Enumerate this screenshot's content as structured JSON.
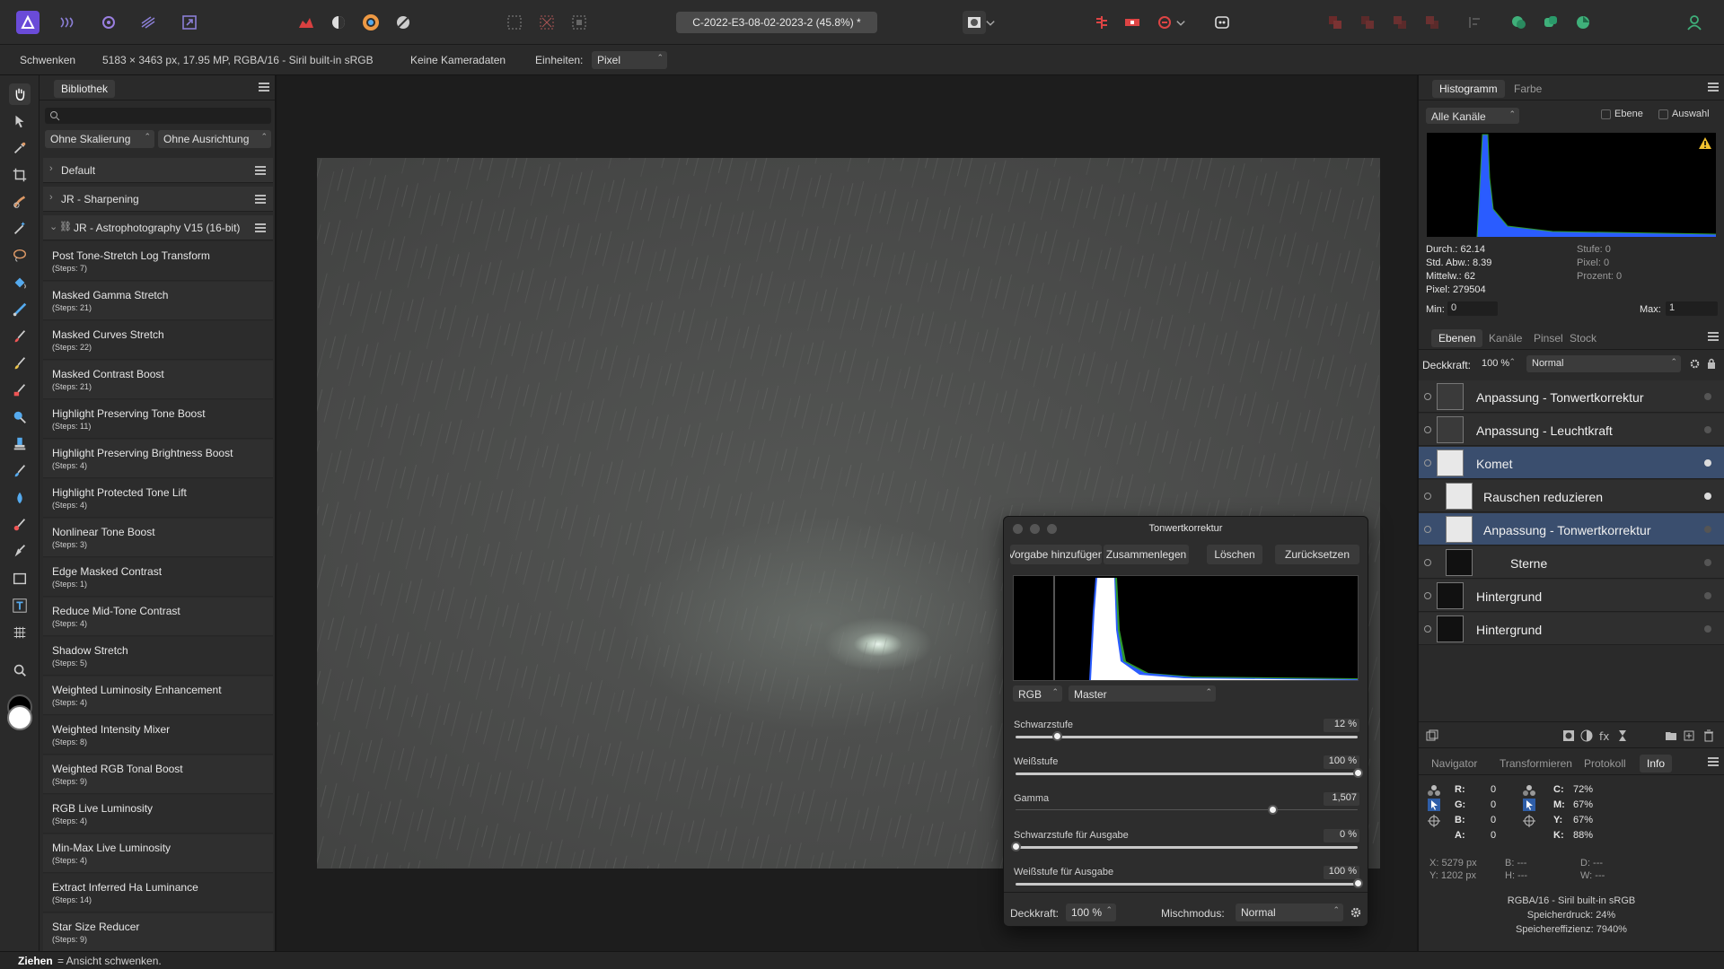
{
  "toolbar": {
    "document_title": "C-2022-E3-08-02-2023-2 (45.8%)",
    "document_modified": "*"
  },
  "context": {
    "tool": "Schwenken",
    "image_info": "5183 × 3463 px, 17.95 MP, RGBA/16 - Siril built-in sRGB",
    "camera": "Keine Kameradaten",
    "units_label": "Einheiten:",
    "units_value": "Pixel"
  },
  "library": {
    "tab": "Bibliothek",
    "search_placeholder": "",
    "scale_select": "Ohne Skalierung",
    "align_select": "Ohne Ausrichtung",
    "groups": [
      {
        "label": "Default",
        "expanded": false
      },
      {
        "label": "JR - Sharpening",
        "expanded": false
      },
      {
        "label": "JR - Astrophotography V15 (16-bit)",
        "expanded": true
      }
    ],
    "macros": [
      {
        "name": "Post Tone-Stretch Log Transform",
        "steps": "(Steps: 7)"
      },
      {
        "name": "Masked Gamma Stretch",
        "steps": "(Steps: 21)"
      },
      {
        "name": "Masked Curves Stretch",
        "steps": "(Steps: 22)"
      },
      {
        "name": "Masked Contrast Boost",
        "steps": "(Steps: 21)"
      },
      {
        "name": "Highlight Preserving Tone Boost",
        "steps": "(Steps: 11)"
      },
      {
        "name": "Highlight Preserving Brightness Boost",
        "steps": "(Steps: 4)"
      },
      {
        "name": "Highlight Protected Tone Lift",
        "steps": "(Steps: 4)"
      },
      {
        "name": "Nonlinear Tone Boost",
        "steps": "(Steps: 3)"
      },
      {
        "name": "Edge Masked Contrast",
        "steps": "(Steps: 1)"
      },
      {
        "name": "Reduce Mid-Tone Contrast",
        "steps": "(Steps: 4)"
      },
      {
        "name": "Shadow Stretch",
        "steps": "(Steps: 5)"
      },
      {
        "name": "Weighted Luminosity Enhancement",
        "steps": "(Steps: 4)"
      },
      {
        "name": "Weighted Intensity Mixer",
        "steps": "(Steps: 8)"
      },
      {
        "name": "Weighted RGB Tonal Boost",
        "steps": "(Steps: 9)"
      },
      {
        "name": "RGB Live Luminosity",
        "steps": "(Steps: 4)"
      },
      {
        "name": "Min-Max Live Luminosity",
        "steps": "(Steps: 4)"
      },
      {
        "name": "Extract Inferred Ha Luminance",
        "steps": "(Steps: 14)"
      },
      {
        "name": "Star Size Reducer",
        "steps": "(Steps: 9)"
      }
    ]
  },
  "histogram_panel": {
    "tab_active": "Histogramm",
    "tab_other": "Farbe",
    "channel": "Alle Kanäle",
    "check_layer": "Ebene",
    "check_selection": "Auswahl",
    "stats_left": [
      "Durch.: 62.14",
      "Std. Abw.: 8.39",
      "Mittelw.: 62",
      "Pixel: 279504"
    ],
    "stats_right": [
      "Stufe: 0",
      "Pixel: 0",
      "Prozent: 0"
    ],
    "min_label": "Min:",
    "min_value": "0",
    "max_label": "Max:",
    "max_value": "1"
  },
  "layers_panel": {
    "tabs": [
      "Ebenen",
      "Kanäle",
      "Pinsel",
      "Stock"
    ],
    "opacity_label": "Deckkraft:",
    "opacity_value": "100 %",
    "blend_mode": "Normal",
    "layers": [
      {
        "name": "Anpassung - Tonwertkorrektur",
        "selected": false,
        "indent": 0,
        "active": false
      },
      {
        "name": "Anpassung - Leuchtkraft",
        "selected": false,
        "indent": 0,
        "active": false
      },
      {
        "name": "Komet",
        "selected": true,
        "indent": 0,
        "active": true
      },
      {
        "name": "Rauschen reduzieren",
        "selected": false,
        "indent": 1,
        "active": true
      },
      {
        "name": "Anpassung - Tonwertkorrektur",
        "selected": true,
        "indent": 1,
        "active": false
      },
      {
        "name": "Sterne",
        "selected": false,
        "indent": 1,
        "active": false
      },
      {
        "name": "Hintergrund",
        "selected": false,
        "indent": 0,
        "active": false
      },
      {
        "name": "Hintergrund",
        "selected": false,
        "indent": 0,
        "active": false
      }
    ]
  },
  "info_panel": {
    "tabs": [
      "Navigator",
      "Transformieren",
      "Protokoll",
      "Info"
    ],
    "active_tab": "Info",
    "rgba": [
      {
        "k": "R:",
        "v": "0"
      },
      {
        "k": "G:",
        "v": "0"
      },
      {
        "k": "B:",
        "v": "0"
      },
      {
        "k": "A:",
        "v": "0"
      }
    ],
    "cmyk": [
      {
        "k": "C:",
        "v": "72%"
      },
      {
        "k": "M:",
        "v": "67%"
      },
      {
        "k": "Y:",
        "v": "67%"
      },
      {
        "k": "K:",
        "v": "88%"
      }
    ],
    "pos_x": "X: 5279 px",
    "pos_y": "Y: 1202 px",
    "b": "B: ---",
    "h": "H: ---",
    "d": "D: ---",
    "w": "W: ---",
    "profile": "RGBA/16 - Siril built-in sRGB",
    "memory_pressure": "Speicherdruck: 24%",
    "memory_efficiency": "Speichereffizienz: 7940%"
  },
  "levels_dialog": {
    "title": "Tonwertkorrektur",
    "buttons": [
      "Vorgabe hinzufügen",
      "Zusammenlegen",
      "Löschen",
      "Zurücksetzen"
    ],
    "channel_model": "RGB",
    "channel": "Master",
    "sliders": [
      {
        "label": "Schwarzstufe",
        "value": "12 %",
        "position": 0.12
      },
      {
        "label": "Weißstufe",
        "value": "100 %",
        "position": 1.0
      },
      {
        "label": "Gamma",
        "value": "1,507",
        "position": 0.75
      },
      {
        "label": "Schwarzstufe für Ausgabe",
        "value": "0 %",
        "position": 0.0
      },
      {
        "label": "Weißstufe für Ausgabe",
        "value": "100 %",
        "position": 1.0
      }
    ],
    "opacity_label": "Deckkraft:",
    "opacity_value": "100 %",
    "blend_label": "Mischmodus:",
    "blend_value": "Normal"
  },
  "status": {
    "key": "Ziehen",
    "text": " = Ansicht schwenken."
  },
  "colors": {
    "accent": "#3a4e6e",
    "app_logo": "#6a4bd8",
    "histogram_blue": "#2a5cff",
    "histogram_green": "#2e9a2e"
  }
}
